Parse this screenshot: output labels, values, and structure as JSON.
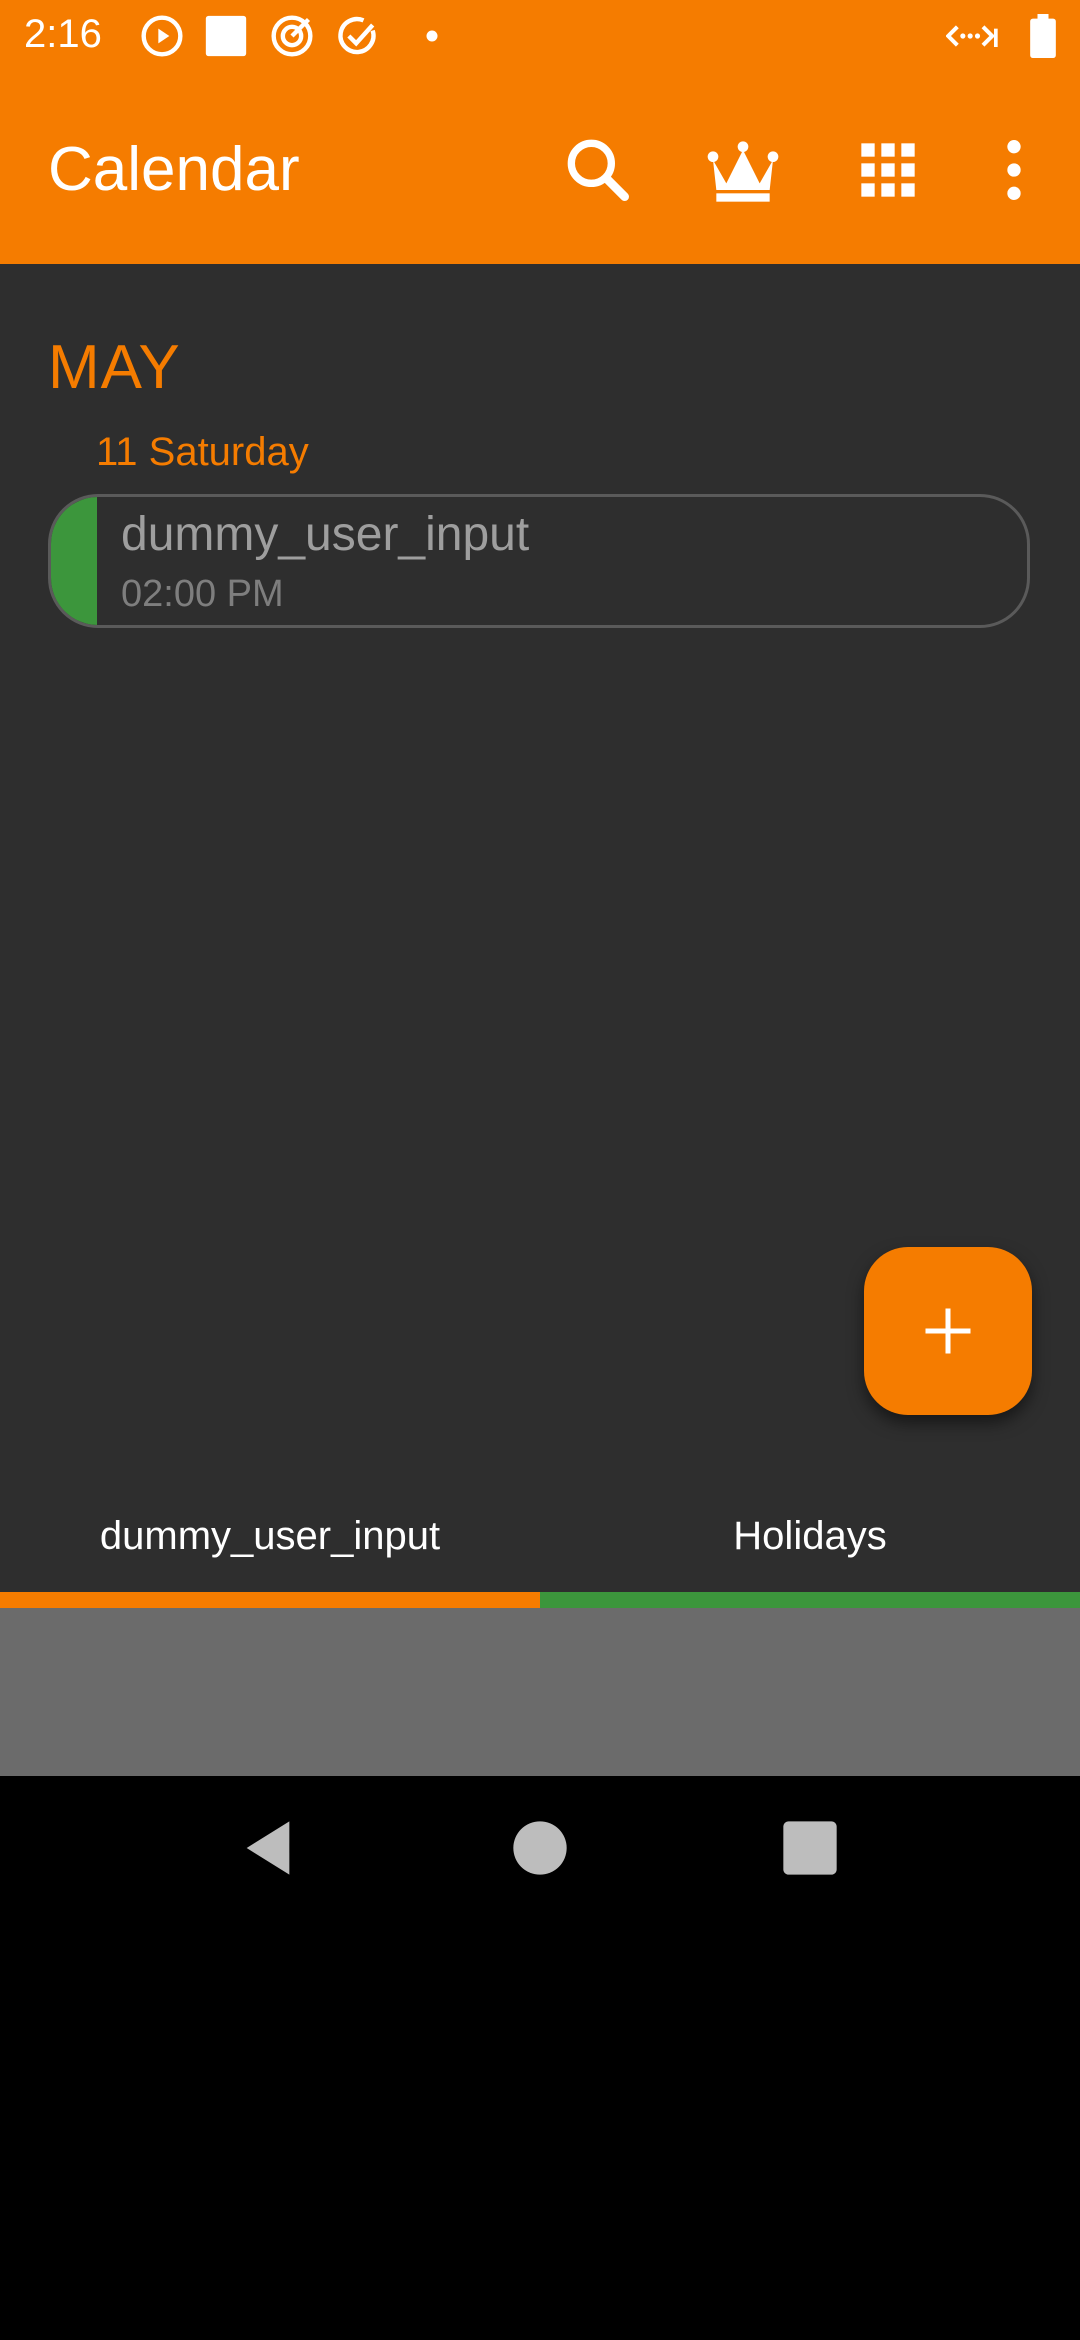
{
  "status_bar": {
    "time": "2:16",
    "left_icons": [
      "play-circle-icon",
      "square-icon",
      "target-icon",
      "check-circle-icon",
      "dot-icon"
    ],
    "right_icons": [
      "data-saver-icon",
      "battery-icon"
    ]
  },
  "app_bar": {
    "title": "Calendar",
    "actions": [
      "search-icon",
      "crown-icon",
      "grid-icon",
      "more-vert-icon"
    ]
  },
  "agenda": {
    "month": "MAY",
    "day": "11 Saturday",
    "event": {
      "title": "dummy_user_input",
      "time": "02:00 PM",
      "color": "#3C963C"
    }
  },
  "fab": {
    "icon": "plus-icon"
  },
  "tabs": [
    {
      "label": "dummy_user_input",
      "color": "#F57C00"
    },
    {
      "label": "Holidays",
      "color": "#3C963C"
    }
  ],
  "nav_bar": [
    "back-icon",
    "home-icon",
    "recents-icon"
  ],
  "colors": {
    "accent": "#F57C00",
    "background": "#2E2E2E"
  }
}
